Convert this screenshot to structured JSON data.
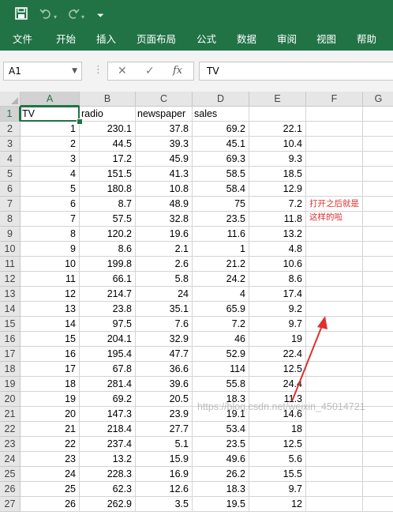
{
  "quick_access": {
    "save_icon": "save-icon",
    "undo_icon": "undo-icon",
    "redo_icon": "redo-icon",
    "customize_icon": "customize-toolbar-icon"
  },
  "ribbon_tabs": [
    "文件",
    "开始",
    "插入",
    "页面布局",
    "公式",
    "数据",
    "审阅",
    "视图",
    "帮助"
  ],
  "formula_bar": {
    "name_box": "A1",
    "cancel_icon": "cancel-icon",
    "enter_icon": "enter-icon",
    "fx_label": "fx",
    "content": "TV"
  },
  "sheet": {
    "columns": [
      "A",
      "B",
      "C",
      "D",
      "E",
      "F",
      "G"
    ],
    "active_cell": "A1",
    "rows": [
      {
        "n": "1",
        "cells": [
          "TV",
          "radio",
          "newspaper",
          "sales",
          ""
        ]
      },
      {
        "n": "2",
        "cells": [
          "1",
          "230.1",
          "37.8",
          "69.2",
          "22.1"
        ]
      },
      {
        "n": "3",
        "cells": [
          "2",
          "44.5",
          "39.3",
          "45.1",
          "10.4"
        ]
      },
      {
        "n": "4",
        "cells": [
          "3",
          "17.2",
          "45.9",
          "69.3",
          "9.3"
        ]
      },
      {
        "n": "5",
        "cells": [
          "4",
          "151.5",
          "41.3",
          "58.5",
          "18.5"
        ]
      },
      {
        "n": "6",
        "cells": [
          "5",
          "180.8",
          "10.8",
          "58.4",
          "12.9"
        ]
      },
      {
        "n": "7",
        "cells": [
          "6",
          "8.7",
          "48.9",
          "75",
          "7.2"
        ]
      },
      {
        "n": "8",
        "cells": [
          "7",
          "57.5",
          "32.8",
          "23.5",
          "11.8"
        ]
      },
      {
        "n": "9",
        "cells": [
          "8",
          "120.2",
          "19.6",
          "11.6",
          "13.2"
        ]
      },
      {
        "n": "10",
        "cells": [
          "9",
          "8.6",
          "2.1",
          "1",
          "4.8"
        ]
      },
      {
        "n": "11",
        "cells": [
          "10",
          "199.8",
          "2.6",
          "21.2",
          "10.6"
        ]
      },
      {
        "n": "12",
        "cells": [
          "11",
          "66.1",
          "5.8",
          "24.2",
          "8.6"
        ]
      },
      {
        "n": "13",
        "cells": [
          "12",
          "214.7",
          "24",
          "4",
          "17.4"
        ]
      },
      {
        "n": "14",
        "cells": [
          "13",
          "23.8",
          "35.1",
          "65.9",
          "9.2"
        ]
      },
      {
        "n": "15",
        "cells": [
          "14",
          "97.5",
          "7.6",
          "7.2",
          "9.7"
        ]
      },
      {
        "n": "16",
        "cells": [
          "15",
          "204.1",
          "32.9",
          "46",
          "19"
        ]
      },
      {
        "n": "17",
        "cells": [
          "16",
          "195.4",
          "47.7",
          "52.9",
          "22.4"
        ]
      },
      {
        "n": "18",
        "cells": [
          "17",
          "67.8",
          "36.6",
          "114",
          "12.5"
        ]
      },
      {
        "n": "19",
        "cells": [
          "18",
          "281.4",
          "39.6",
          "55.8",
          "24.4"
        ]
      },
      {
        "n": "20",
        "cells": [
          "19",
          "69.2",
          "20.5",
          "18.3",
          "11.3"
        ]
      },
      {
        "n": "21",
        "cells": [
          "20",
          "147.3",
          "23.9",
          "19.1",
          "14.6"
        ]
      },
      {
        "n": "22",
        "cells": [
          "21",
          "218.4",
          "27.7",
          "53.4",
          "18"
        ]
      },
      {
        "n": "23",
        "cells": [
          "22",
          "237.4",
          "5.1",
          "23.5",
          "12.5"
        ]
      },
      {
        "n": "24",
        "cells": [
          "23",
          "13.2",
          "15.9",
          "49.6",
          "5.6"
        ]
      },
      {
        "n": "25",
        "cells": [
          "24",
          "228.3",
          "16.9",
          "26.2",
          "15.5"
        ]
      },
      {
        "n": "26",
        "cells": [
          "25",
          "62.3",
          "12.6",
          "18.3",
          "9.7"
        ]
      },
      {
        "n": "27",
        "cells": [
          "26",
          "262.9",
          "3.5",
          "19.5",
          "12"
        ]
      }
    ]
  },
  "annotation": {
    "line1": "打开之后就是",
    "line2": "这样的啦",
    "color": "#e03030"
  },
  "watermark": "https://blog.csdn.net/weixin_45014721",
  "colors": {
    "excel_green": "#217346",
    "annotation_red": "#e03030"
  }
}
